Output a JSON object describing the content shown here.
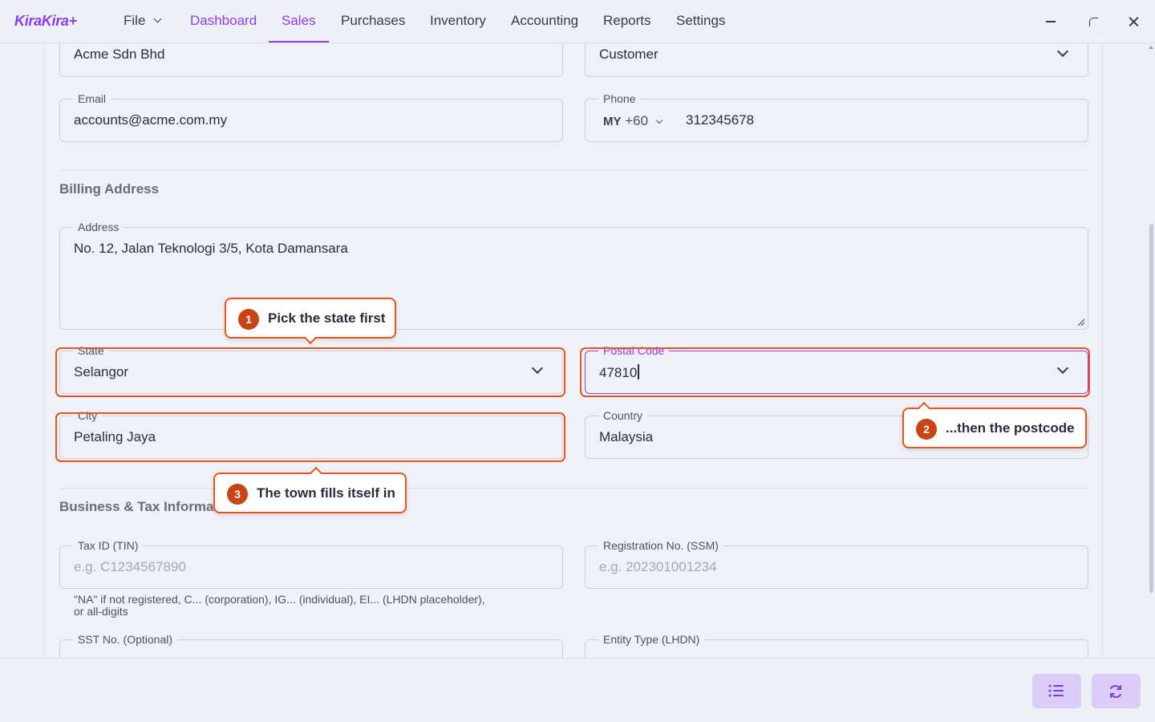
{
  "app": {
    "logo": "KiraKira+"
  },
  "nav": {
    "file": "File",
    "items": [
      "Dashboard",
      "Sales",
      "Purchases",
      "Inventory",
      "Accounting",
      "Reports",
      "Settings"
    ],
    "active": "Sales"
  },
  "form": {
    "company_name_value": "Acme Sdn Bhd",
    "contact_type_value": "Customer",
    "email": {
      "label": "Email",
      "value": "accounts@acme.com.my"
    },
    "phone": {
      "label": "Phone",
      "country": "MY",
      "code": "+60",
      "value": "312345678"
    },
    "billing_title": "Billing Address",
    "address": {
      "label": "Address",
      "value": "No. 12, Jalan Teknologi 3/5, Kota Damansara"
    },
    "state": {
      "label": "State",
      "value": "Selangor"
    },
    "postal_code": {
      "label": "Postal Code",
      "value": "47810"
    },
    "city": {
      "label": "City",
      "value": "Petaling Jaya"
    },
    "country": {
      "label": "Country",
      "value": "Malaysia"
    },
    "business_title": "Business & Tax Informat",
    "tin": {
      "label": "Tax ID (TIN)",
      "placeholder": "e.g. C1234567890",
      "help_line1": "\"NA\" if not registered, C... (corporation), IG... (individual), EI... (LHDN placeholder),",
      "help_line2": "or all-digits"
    },
    "ssm": {
      "label": "Registration No. (SSM)",
      "placeholder": "e.g. 202301001234"
    },
    "sst": {
      "label": "SST No. (Optional)"
    },
    "entity_type": {
      "label": "Entity Type (LHDN)"
    }
  },
  "callouts": [
    {
      "num": "1",
      "text": "Pick the state first"
    },
    {
      "num": "2",
      "text": "...then the postcode"
    },
    {
      "num": "3",
      "text": "The town fills itself in"
    }
  ],
  "colors": {
    "accent": "#8b3df0",
    "highlight": "#e8541a",
    "badge": "#c94315"
  }
}
